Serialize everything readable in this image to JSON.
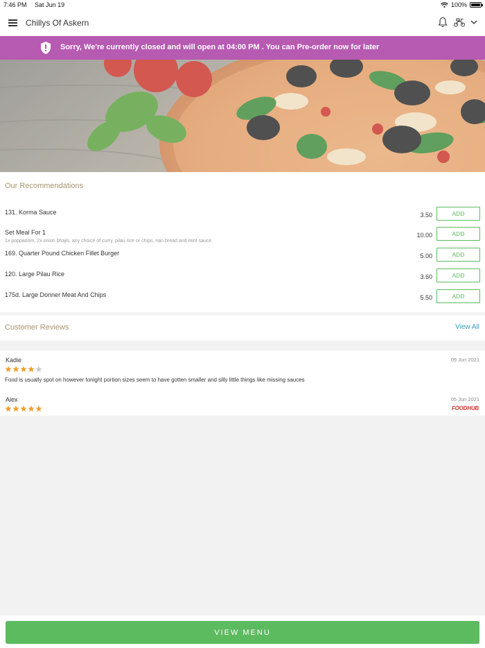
{
  "status_bar": {
    "time": "7:46 PM",
    "date": "Sat Jun 19",
    "battery": "100%"
  },
  "header": {
    "title": "Chillys Of Askern"
  },
  "banner": {
    "text": "Sorry, We're currently closed and will open at 04:00 PM . You can Pre-order now for later",
    "color": "#b65ab2"
  },
  "recommendations": {
    "title": "Our Recommendations",
    "add_label": "ADD",
    "items": [
      {
        "name": "131. Korma Sauce",
        "desc": "",
        "price": "3.50"
      },
      {
        "name": "Set Meal For 1",
        "desc": "1x poppadom, 2x onion bhajis, any choice of curry, pilau rice or chips, nan bread and mint sauce",
        "price": "10.00"
      },
      {
        "name": "169. Quarter Pound Chicken Fillet Burger",
        "desc": "",
        "price": "5.00"
      },
      {
        "name": "120. Large Pilau Rice",
        "desc": "",
        "price": "3.60"
      },
      {
        "name": "175d. Large Donner Meat And Chips",
        "desc": "",
        "price": "5.50"
      }
    ]
  },
  "reviews": {
    "title": "Customer Reviews",
    "view_all": "View All",
    "items": [
      {
        "name": "Kadie",
        "date": "09 Jun 2021",
        "rating": 4,
        "text": "Food is usually spot on however tonight portion sizes seem to have gotten smaller and silly little things like missing sauces"
      },
      {
        "name": "Alex",
        "date": "05 Jun 2021",
        "rating": 5,
        "text": "",
        "source": "FOODHUB"
      }
    ]
  },
  "footer": {
    "button": "VIEW MENU"
  },
  "colors": {
    "accent": "#5cba5f",
    "banner": "#b65ab2",
    "section_title": "#a8946c",
    "link": "#3a9bc2",
    "star": "#f0a030"
  },
  "icons": [
    "menu-icon",
    "bell-icon",
    "scooter-icon",
    "chevron-down-icon",
    "shield-icon",
    "wifi-icon",
    "battery-icon",
    "star-icon"
  ]
}
